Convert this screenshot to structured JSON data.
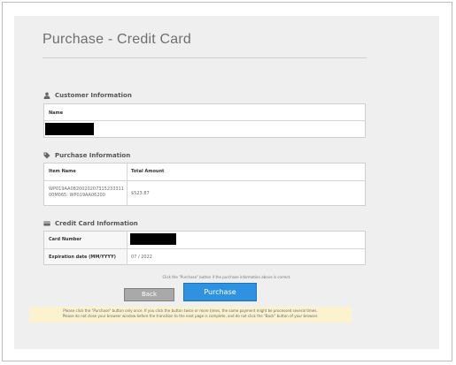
{
  "page": {
    "title": "Purchase - Credit Card"
  },
  "customer": {
    "section_title": "Customer Information",
    "icon": "user-icon",
    "name_label": "Name"
  },
  "purchase": {
    "section_title": "Purchase Information",
    "icon": "tag-icon",
    "col_item": "Item Name",
    "col_total": "Total Amount",
    "item_line1": "WP019AA0820020207315233311",
    "item_line2": "00M065: WP019AA06200",
    "total": "$523.87"
  },
  "card": {
    "section_title": "Credit Card Information",
    "icon": "credit-card-icon",
    "number_label": "Card Number",
    "expiry_label": "Expiration date (MM/YYYY)",
    "expiry_value": "07 / 2022"
  },
  "actions": {
    "confirm_note": "Click the \"Purchase\" button if the purchase information above is correct.",
    "back_label": "Back",
    "purchase_label": "Purchase"
  },
  "warning": {
    "line1": "Please click the \"Purchase\" button only once. If you click the button twice or more times, the same payment might be processed several times.",
    "line2": "Please do not close your browser window before the transition to the next page is complete, and do not click the \"Back\" button of your browser."
  },
  "colors": {
    "accent": "#2e92e0",
    "panel": "#efefef",
    "warning_bg": "#fbf2cf"
  }
}
